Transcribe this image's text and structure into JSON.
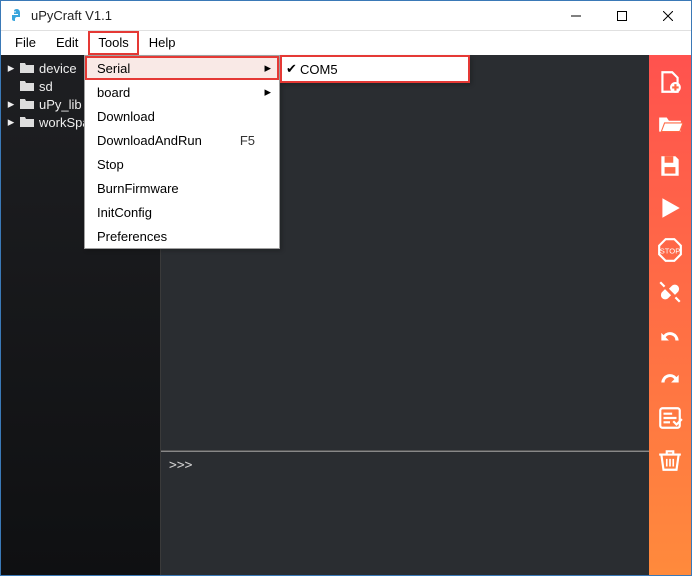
{
  "titlebar": {
    "title": "uPyCraft V1.1"
  },
  "menubar": {
    "items": [
      {
        "label": "File"
      },
      {
        "label": "Edit"
      },
      {
        "label": "Tools"
      },
      {
        "label": "Help"
      }
    ]
  },
  "sidebar": {
    "items": [
      {
        "label": "device"
      },
      {
        "label": "sd"
      },
      {
        "label": "uPy_lib"
      },
      {
        "label": "workSpace"
      }
    ]
  },
  "tools_menu": {
    "items": [
      {
        "label": "Serial",
        "submenu": true
      },
      {
        "label": "board",
        "submenu": true
      },
      {
        "label": "Download"
      },
      {
        "label": "DownloadAndRun",
        "shortcut": "F5"
      },
      {
        "label": "Stop"
      },
      {
        "label": "BurnFirmware"
      },
      {
        "label": "InitConfig"
      },
      {
        "label": "Preferences"
      }
    ]
  },
  "serial_submenu": {
    "items": [
      {
        "label": "COM5",
        "checked": true
      }
    ]
  },
  "console": {
    "prompt": ">>>"
  },
  "right_toolbar": {
    "icons": [
      "new-file-icon",
      "open-file-icon",
      "save-icon",
      "run-icon",
      "stop-icon",
      "connect-icon",
      "undo-icon",
      "redo-icon",
      "syntax-check-icon",
      "clear-icon"
    ]
  },
  "colors": {
    "highlight_border": "#e53935",
    "toolbar_gradient_top": "#ff524e",
    "toolbar_gradient_bottom": "#ff8a3c",
    "editor_bg": "#2a2d31"
  }
}
